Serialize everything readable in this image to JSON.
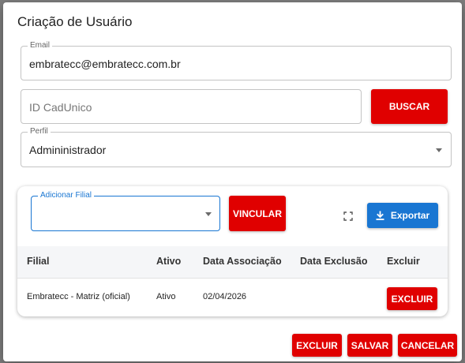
{
  "dialog": {
    "title": "Criação de Usuário"
  },
  "email": {
    "legend": "Email",
    "value": "embratecc@embratecc.com.br"
  },
  "cadunico": {
    "placeholder": "ID CadUnico",
    "search_label": "BUSCAR"
  },
  "perfil": {
    "legend": "Perfil",
    "value": "Admininistrador"
  },
  "filial_section": {
    "input_legend": "Adicionar Filial",
    "input_value": "",
    "link_label": "VINCULAR",
    "fullscreen_icon": "fullscreen-icon",
    "export_icon": "download-icon",
    "export_label": "Exportar"
  },
  "table": {
    "columns": [
      "Filial",
      "Ativo",
      "Data Associação",
      "Data Exclusão",
      "Excluir"
    ],
    "rows": [
      {
        "filial": "Embratecc - Matriz (oficial)",
        "ativo": "Ativo",
        "data_associacao": "02/04/2026",
        "data_exclusao": "",
        "excluir_label": "EXCLUIR"
      }
    ]
  },
  "footer": {
    "delete_label": "EXCLUIR",
    "save_label": "SALVAR",
    "cancel_label": "CANCELAR"
  },
  "colors": {
    "primary_red": "#e00000",
    "primary_blue": "#1976d2",
    "overlay": "#7d7d7d"
  }
}
